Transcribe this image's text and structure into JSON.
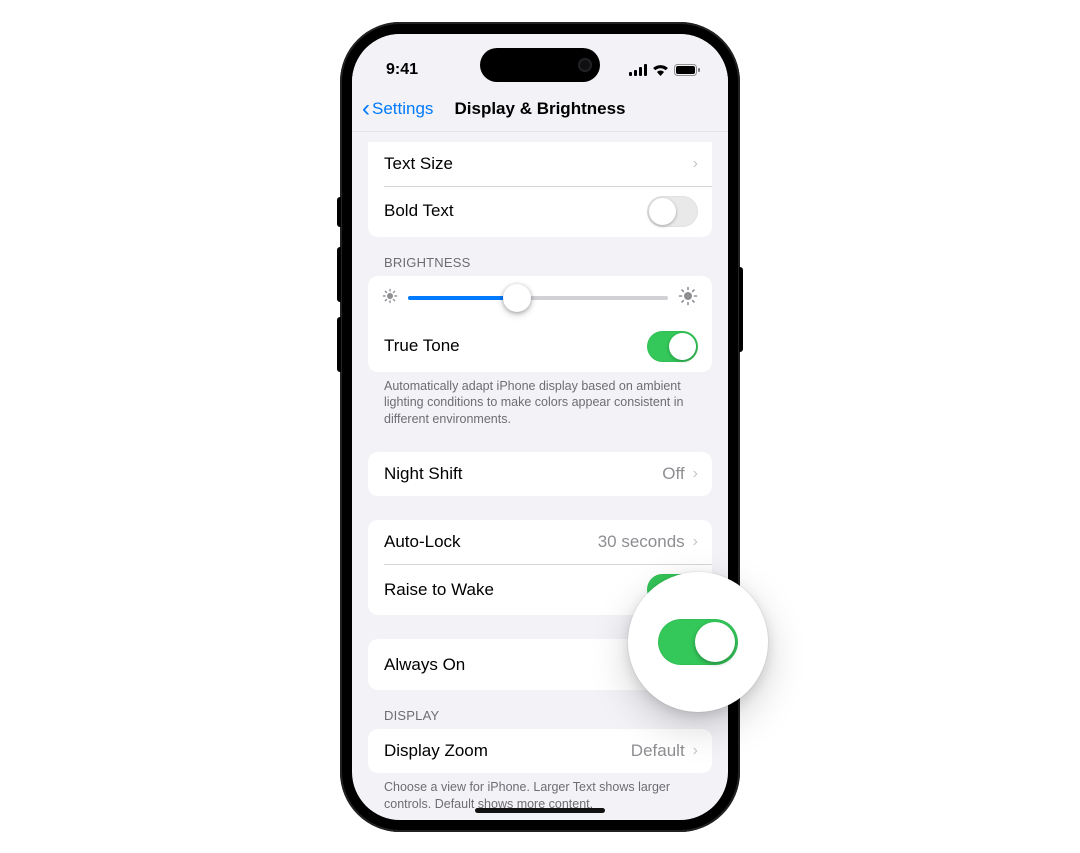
{
  "status": {
    "time": "9:41"
  },
  "nav": {
    "back": "Settings",
    "title": "Display & Brightness"
  },
  "rows": {
    "textSize": "Text Size",
    "boldText": "Bold Text",
    "trueTone": "True Tone",
    "nightShift": "Night Shift",
    "nightShiftValue": "Off",
    "autoLock": "Auto-Lock",
    "autoLockValue": "30 seconds",
    "raiseToWake": "Raise to Wake",
    "alwaysOn": "Always On",
    "displayZoom": "Display Zoom",
    "displayZoomValue": "Default"
  },
  "headers": {
    "brightness": "BRIGHTNESS",
    "display": "DISPLAY"
  },
  "footers": {
    "trueTone": "Automatically adapt iPhone display based on ambient lighting conditions to make colors appear consistent in different environments.",
    "displayZoom": "Choose a view for iPhone. Larger Text shows larger controls. Default shows more content."
  },
  "toggles": {
    "boldText": false,
    "trueTone": true,
    "raiseToWake": true,
    "alwaysOn": true
  },
  "slider": {
    "brightnessPercent": 42
  }
}
